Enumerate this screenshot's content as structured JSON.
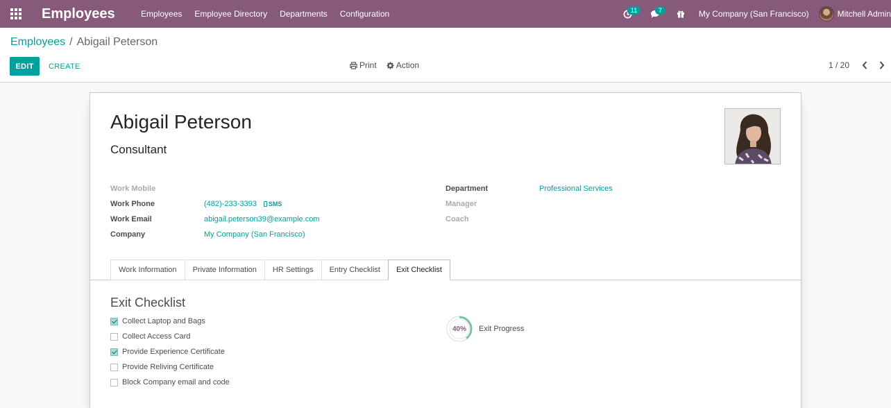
{
  "navbar": {
    "app_title": "Employees",
    "menu": [
      "Employees",
      "Employee Directory",
      "Departments",
      "Configuration"
    ],
    "activity_count": "11",
    "message_count": "7",
    "company": "My Company (San Francisco)",
    "user": "Mitchell Admin",
    "color": "#875a7b"
  },
  "control_panel": {
    "breadcrumb_root": "Employees",
    "breadcrumb_separator": "/",
    "breadcrumb_current": "Abigail Peterson",
    "edit_label": "EDIT",
    "create_label": "CREATE",
    "print_label": "Print",
    "action_label": "Action",
    "pager": "1 / 20"
  },
  "employee": {
    "name": "Abigail Peterson",
    "job_title": "Consultant",
    "left_fields": [
      {
        "label": "Work Mobile",
        "value": ""
      },
      {
        "label": "Work Phone",
        "value": "(482)-233-3393",
        "sms": "SMS"
      },
      {
        "label": "Work Email",
        "value": "abigail.peterson39@example.com"
      },
      {
        "label": "Company",
        "value": "My Company (San Francisco)"
      }
    ],
    "right_fields": [
      {
        "label": "Department",
        "value": "Professional Services"
      },
      {
        "label": "Manager",
        "value": ""
      },
      {
        "label": "Coach",
        "value": ""
      }
    ]
  },
  "tabs": [
    "Work Information",
    "Private Information",
    "HR Settings",
    "Entry Checklist",
    "Exit Checklist"
  ],
  "active_tab": "Exit Checklist",
  "exit_checklist": {
    "title": "Exit Checklist",
    "items": [
      {
        "label": "Collect Laptop and Bags",
        "checked": true
      },
      {
        "label": "Collect Access Card",
        "checked": false
      },
      {
        "label": "Provide Experience Certificate",
        "checked": true
      },
      {
        "label": "Provide Reliving Certificate",
        "checked": false
      },
      {
        "label": "Block Company email and code",
        "checked": false
      }
    ],
    "progress_text": "40%",
    "progress_value": 0.4,
    "progress_label": "Exit Progress"
  },
  "colors": {
    "accent": "#00a09d",
    "brand": "#875a7b"
  }
}
